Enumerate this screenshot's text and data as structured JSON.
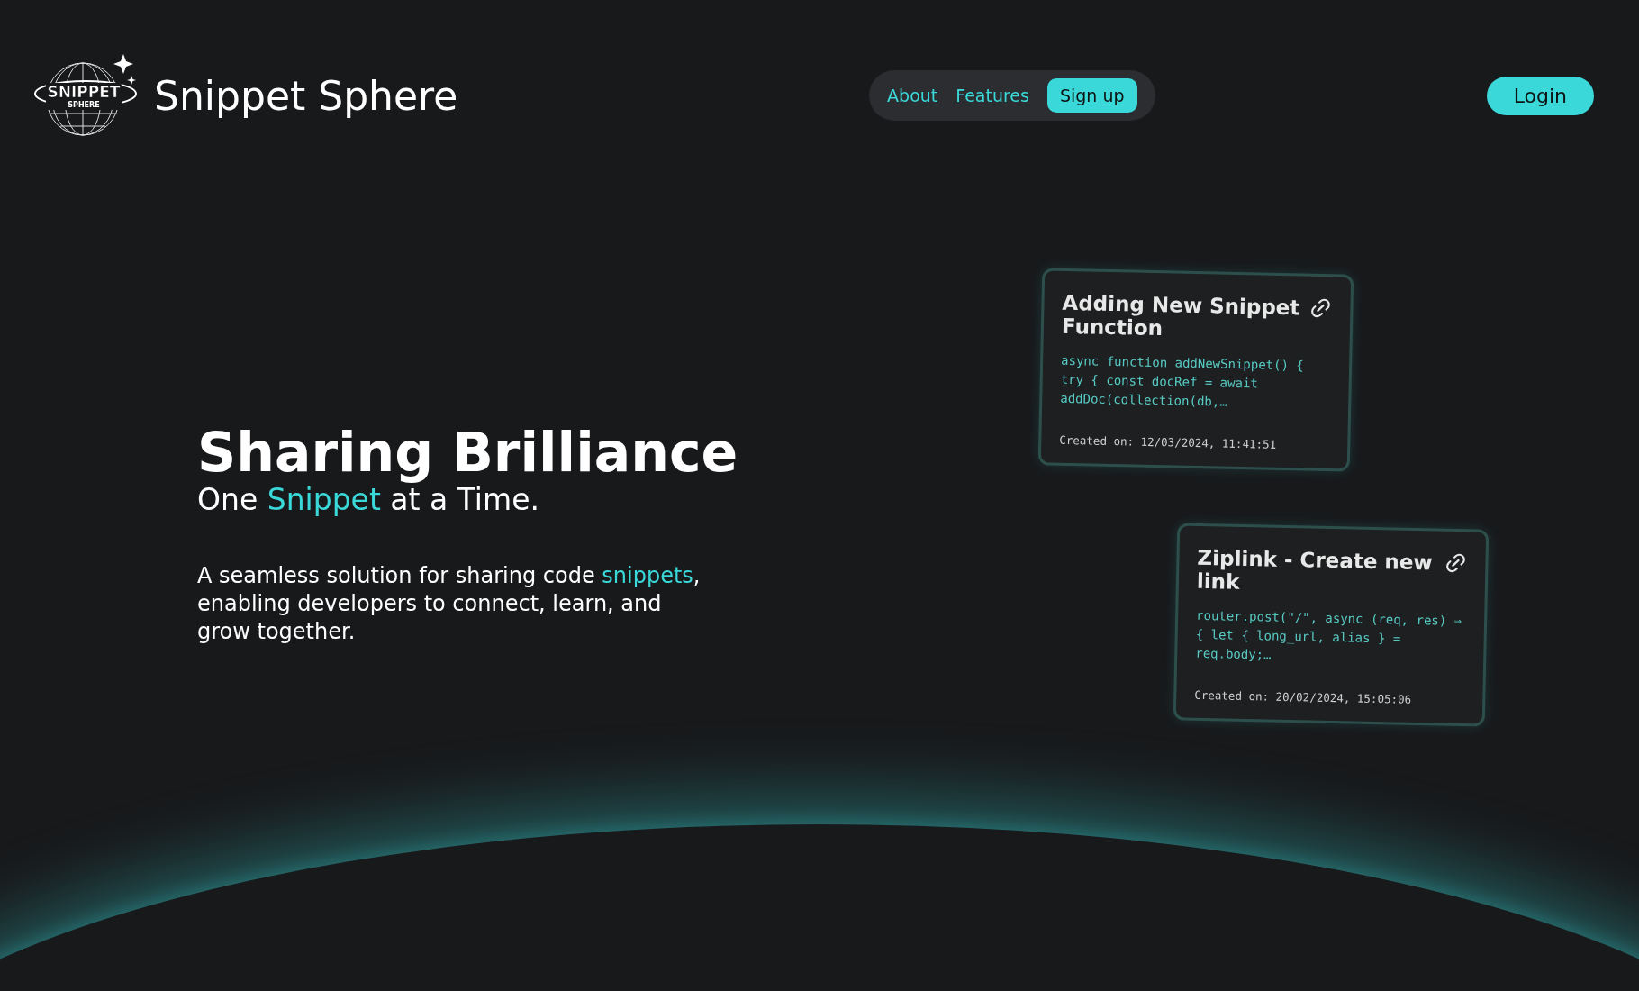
{
  "header": {
    "logo": {
      "text": "SNIPPET",
      "subtext": "SPHERE"
    },
    "brand": "Snippet Sphere",
    "nav": [
      {
        "label": "About",
        "kind": "link"
      },
      {
        "label": "Features",
        "kind": "link"
      },
      {
        "label": "Sign up",
        "kind": "pill"
      }
    ],
    "login": "Login"
  },
  "hero": {
    "title": "Sharing Brilliance",
    "subtitle": "One *Snippet* at a Time.",
    "description": "A seamless solution for sharing code *snippets*, enabling developers to connect, learn, and grow together."
  },
  "cards": [
    {
      "title": "Adding New Snippet Function",
      "code": "async function addNewSnippet() { try { const docRef = await addDoc(collection(db,…",
      "created": "Created on: 12/03/2024, 11:41:51"
    },
    {
      "title": "Ziplink - Create new link",
      "code": "router.post(\"/\", async (req, res) ⇒ { let { long_url, alias } = req.body;…",
      "created": "Created on: 20/02/2024, 15:05:06"
    }
  ]
}
